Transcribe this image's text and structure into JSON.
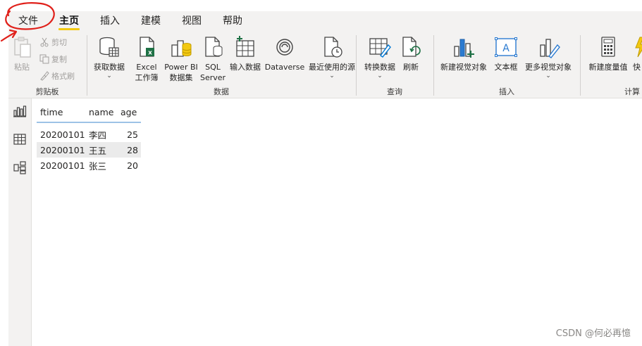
{
  "menu": {
    "tabs": [
      {
        "label": "文件"
      },
      {
        "label": "主页"
      },
      {
        "label": "插入"
      },
      {
        "label": "建模"
      },
      {
        "label": "视图"
      },
      {
        "label": "帮助"
      }
    ],
    "active_tab": "主页"
  },
  "ribbon": {
    "clipboard": {
      "label": "剪贴板",
      "paste": "粘贴",
      "cut": "剪切",
      "copy": "复制",
      "format_painter": "格式刷"
    },
    "data": {
      "label": "数据",
      "get_data": "获取数据",
      "excel_line1": "Excel",
      "excel_line2": "工作簿",
      "powerbi_line1": "Power BI",
      "powerbi_line2": "数据集",
      "sql_line1": "SQL",
      "sql_line2": "Server",
      "enter_data": "输入数据",
      "dataverse": "Dataverse",
      "recent_sources": "最近使用的源"
    },
    "query": {
      "label": "查询",
      "transform": "转换数据",
      "refresh": "刷新"
    },
    "insert": {
      "label": "插入",
      "new_visual": "新建视觉对象",
      "text_box": "文本框",
      "more_visuals": "更多视觉对象"
    },
    "calc": {
      "label": "计算",
      "new_measure": "新建度量值",
      "quick": "快"
    }
  },
  "table": {
    "columns": [
      "ftime",
      "name",
      "age"
    ],
    "rows": [
      [
        "20200101",
        "李四",
        "25"
      ],
      [
        "20200101",
        "王五",
        "28"
      ],
      [
        "20200101",
        "张三",
        "20"
      ]
    ]
  },
  "watermark": "CSDN @何必再憶",
  "colors": {
    "accent_yellow": "#f2c811",
    "ribbon_bg": "#f3f2f1",
    "annotation_red": "#e0201a",
    "header_underline": "#9dc3e6"
  },
  "icons": {
    "rail": [
      "report-view-icon",
      "data-view-icon",
      "model-view-icon"
    ]
  }
}
